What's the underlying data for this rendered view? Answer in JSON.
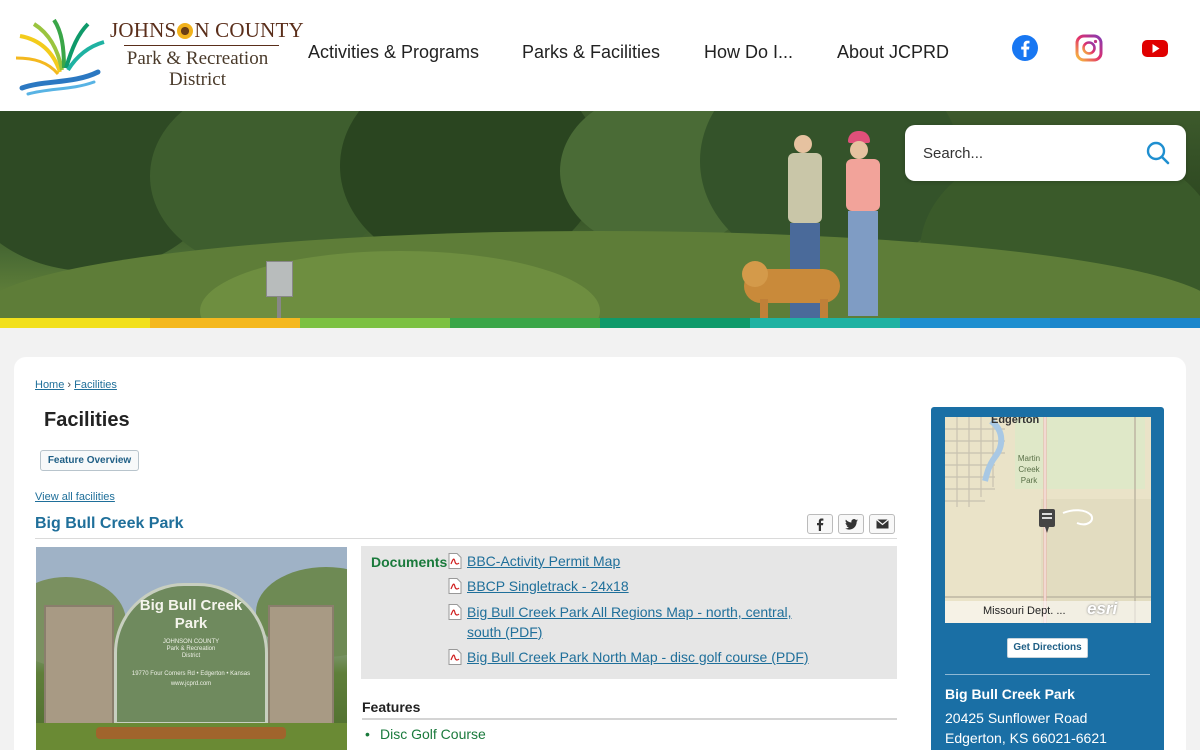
{
  "logo": {
    "line1_a": "JOHNS",
    "line1_b": "N COUNTY",
    "line2": "Park & Recreation",
    "line3": "District"
  },
  "nav": [
    {
      "label": "Activities & Programs"
    },
    {
      "label": "Parks & Facilities"
    },
    {
      "label": "How Do I..."
    },
    {
      "label": "About JCPRD"
    }
  ],
  "social": [
    {
      "icon": "facebook-icon",
      "color": "#1877f2"
    },
    {
      "icon": "instagram-icon",
      "color": "#c13584"
    },
    {
      "icon": "youtube-icon",
      "color": "#e00000"
    }
  ],
  "search": {
    "placeholder": "Search..."
  },
  "colorbar": [
    "#f2e01c",
    "#f4b81f",
    "#7cc142",
    "#3aa648",
    "#0f9a6a",
    "#1fb2a2",
    "#1e8fd0",
    "#1b86cc"
  ],
  "breadcrumb": {
    "home": "Home",
    "sep": "›",
    "current": "Facilities"
  },
  "page": {
    "title": "Facilities",
    "feature_overview": "Feature Overview",
    "view_all": "View all facilities",
    "facility_name": "Big Bull Creek Park"
  },
  "sign": {
    "title_line1": "Big Bull Creek",
    "title_line2": "Park",
    "org_line1": "JOHNSON COUNTY",
    "org_line2": "Park & Recreation",
    "org_line3": "District",
    "address": "19770 Four Corners Rd • Edgerton • Kansas",
    "url": "www.jcprd.com"
  },
  "documents": {
    "label": "Documents",
    "items": [
      "BBC-Activity Permit Map",
      "BBCP Singletrack - 24x18",
      "Big Bull Creek Park All Regions Map - north, central,",
      "south (PDF)",
      "Big Bull Creek Park North Map - disc golf course (PDF)"
    ]
  },
  "features": {
    "title": "Features",
    "items": [
      "Disc Golf Course"
    ]
  },
  "map": {
    "town": "Edgerton",
    "park_label_1": "Martin",
    "park_label_2": "Creek",
    "park_label_3": "Park",
    "credit": "Missouri Dept. ...",
    "esri": "esri"
  },
  "sidebar": {
    "directions": "Get Directions",
    "name": "Big Bull Creek Park",
    "address_line1": "20425 Sunflower Road",
    "address_line2": "Edgerton, KS 66021-6621"
  }
}
